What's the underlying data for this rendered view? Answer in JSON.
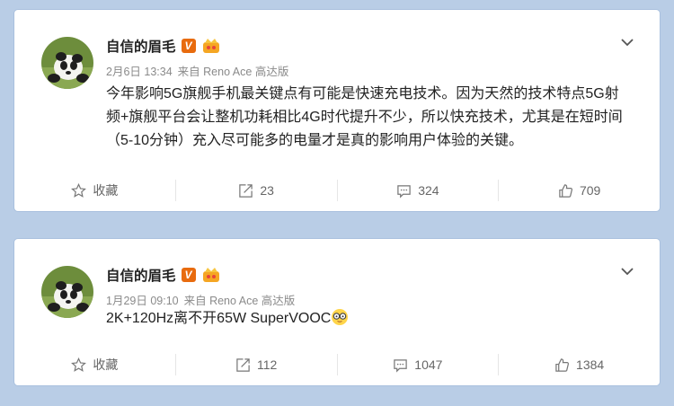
{
  "posts": [
    {
      "author": "自信的眉毛",
      "verified_badge": "V",
      "date": "2月6日 13:34",
      "source": "来自 Reno Ace 高达版",
      "text": "今年影响5G旗舰手机最关键点有可能是快速充电技术。因为天然的技术特点5G射频+旗舰平台会让整机功耗相比4G时代提升不少，所以快充技术，尤其是在短时间（5-10分钟）充入尽可能多的电量才是真的影响用户体验的关键。",
      "actions": {
        "favorite": "收藏",
        "repost": "23",
        "comment": "324",
        "like": "709"
      }
    },
    {
      "author": "自信的眉毛",
      "verified_badge": "V",
      "date": "1月29日 09:10",
      "source": "来自 Reno Ace 高达版",
      "text": "2K+120Hz离不开65W SuperVOOC",
      "emoji": "glasses-emoji",
      "actions": {
        "favorite": "收藏",
        "repost": "112",
        "comment": "1047",
        "like": "1384"
      }
    }
  ],
  "colors": {
    "background": "#b9cde6",
    "card": "#ffffff",
    "vbadge": "#e86b0e",
    "meta_text": "#8a8a8a"
  }
}
